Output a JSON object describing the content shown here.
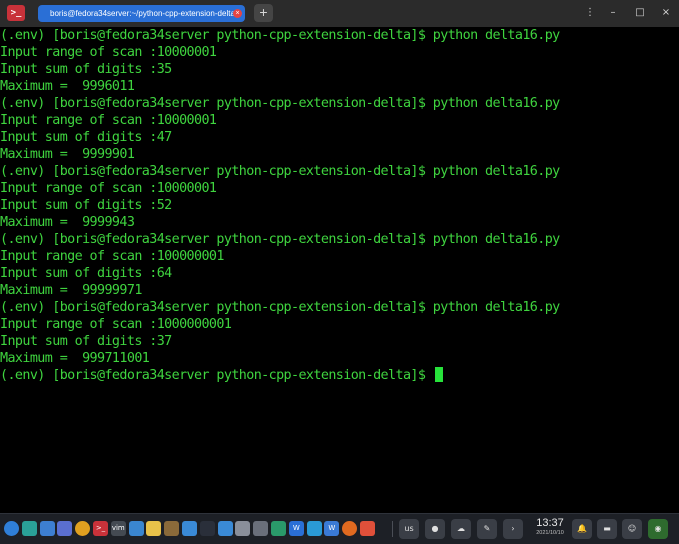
{
  "window": {
    "app_icon_glyph": ">_",
    "tab_title": "boris@fedora34server:~/python-cpp-extension-delta",
    "tab_close_glyph": "×",
    "new_tab_glyph": "+",
    "controls": {
      "menu": "⋮",
      "minimize": "–",
      "maximize": "□",
      "close": "×"
    }
  },
  "terminal": {
    "lines": [
      "(.env) [boris@fedora34server python-cpp-extension-delta]$ python delta16.py",
      "Input range of scan :10000001",
      "Input sum of digits :35",
      "Maximum =  9996011",
      "(.env) [boris@fedora34server python-cpp-extension-delta]$ python delta16.py",
      "Input range of scan :10000001",
      "Input sum of digits :47",
      "Maximum =  9999901",
      "(.env) [boris@fedora34server python-cpp-extension-delta]$ python delta16.py",
      "Input range of scan :10000001",
      "Input sum of digits :52",
      "Maximum =  9999943",
      "(.env) [boris@fedora34server python-cpp-extension-delta]$ python delta16.py",
      "Input range of scan :100000001",
      "Input sum of digits :64",
      "Maximum =  99999971",
      "(.env) [boris@fedora34server python-cpp-extension-delta]$ python delta16.py",
      "Input range of scan :1000000001",
      "Input sum of digits :37",
      "Maximum =  999711001"
    ],
    "prompt": "(.env) [boris@fedora34server python-cpp-extension-delta]$ "
  },
  "taskbar": {
    "apps": [
      {
        "icon": "app-launcher-icon",
        "label": "",
        "color": "#2f7fd8"
      },
      {
        "icon": "terminal-app-icon",
        "label": "",
        "color": "#2aa198"
      },
      {
        "icon": "window-overview-icon",
        "label": "",
        "color": "#3d7fd1"
      },
      {
        "icon": "settings-icon",
        "label": "",
        "color": "#5a6fd0"
      },
      {
        "icon": "chrome-icon",
        "label": "",
        "color": "#e0a020"
      },
      {
        "icon": "terminal-icon",
        "label": ">_",
        "color": "#c8323a"
      },
      {
        "icon": "vim-icon",
        "label": "vim",
        "color": "#444a52"
      },
      {
        "icon": "network-icon",
        "label": "",
        "color": "#3a86d0"
      },
      {
        "icon": "notes-icon",
        "label": "",
        "color": "#e8c24a"
      },
      {
        "icon": "disks-icon",
        "label": "",
        "color": "#8a6a3a"
      },
      {
        "icon": "color-picker-icon",
        "label": "",
        "color": "#3a8ad6"
      },
      {
        "icon": "ide-icon",
        "label": "",
        "color": "#2a2f3a"
      },
      {
        "icon": "app-grid-icon",
        "label": "",
        "color": "#3a8ad6"
      },
      {
        "icon": "help-icon",
        "label": "",
        "color": "#8a8f9a"
      },
      {
        "icon": "media-player-icon",
        "label": "",
        "color": "#6a6f7a"
      },
      {
        "icon": "system-monitor-icon",
        "label": "",
        "color": "#2a9a6a"
      },
      {
        "icon": "word-processor-icon",
        "label": "W",
        "color": "#2a6fd6"
      },
      {
        "icon": "telegram-icon",
        "label": "",
        "color": "#2a9ad6"
      },
      {
        "icon": "wps-icon",
        "label": "W",
        "color": "#3a7ad6"
      },
      {
        "icon": "firefox-icon",
        "label": "",
        "color": "#e06a20"
      },
      {
        "icon": "file-manager-icon",
        "label": "",
        "color": "#e0503a"
      }
    ],
    "indicators": {
      "keyboard_layout": "us",
      "clock_time": "13:37",
      "clock_date": "2021/10/10"
    }
  }
}
